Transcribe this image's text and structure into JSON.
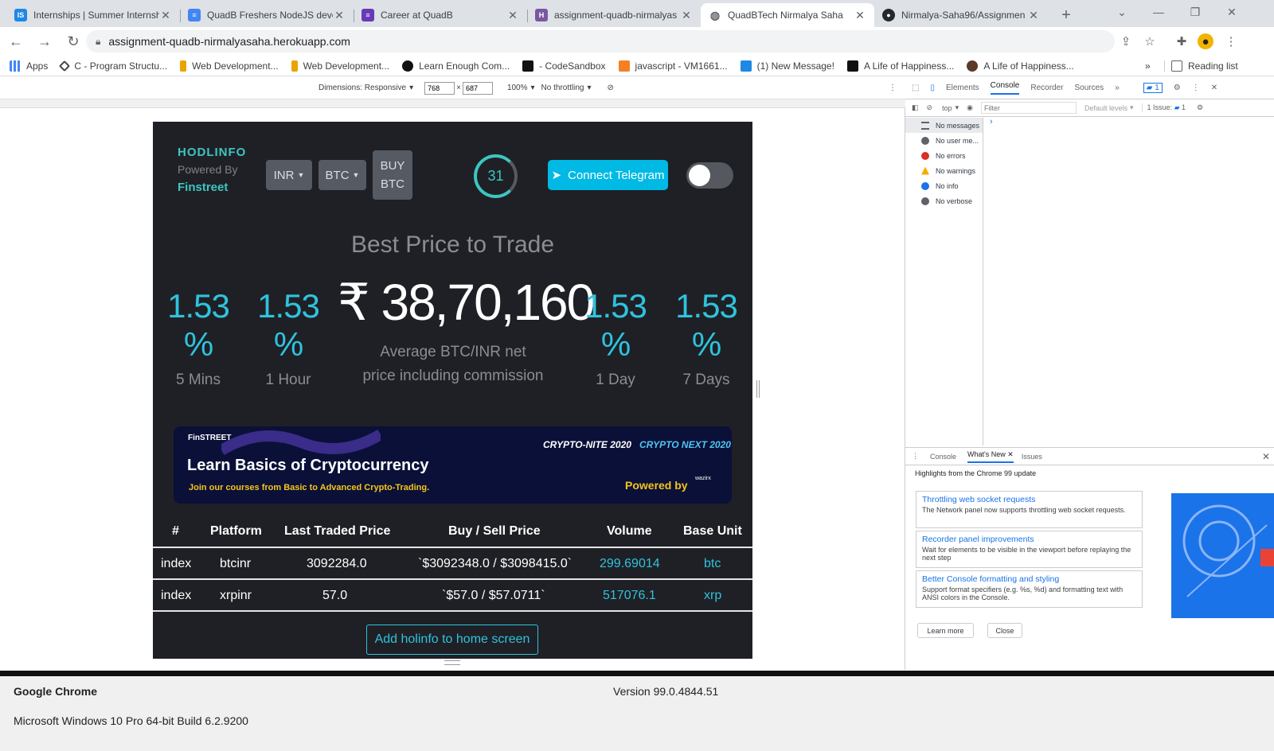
{
  "tabs": [
    {
      "title": "Internships | Summer Internsh",
      "favicon": "IS",
      "color": "#1e88e5"
    },
    {
      "title": "QuadB Freshers NodeJS deve",
      "favicon": "D",
      "color": "#4285f4"
    },
    {
      "title": "Career at QuadB",
      "favicon": "F",
      "color": "#673ab7"
    },
    {
      "title": "assignment-quadb-nirmalyas",
      "favicon": "H",
      "color": "#79589f"
    },
    {
      "title": "QuadBTech Nirmalya Saha",
      "favicon": "G",
      "color": "#5f6368"
    },
    {
      "title": "Nirmalya-Saha96/Assignmen",
      "favicon": "GH",
      "color": "#24292f"
    }
  ],
  "address": {
    "url": "assignment-quadb-nirmalyasaha.herokuapp.com"
  },
  "bookmarks": [
    {
      "label": "Apps",
      "color": "#4285f4"
    },
    {
      "label": "C - Program Structu...",
      "color": "#444"
    },
    {
      "label": "Web Development...",
      "color": "#e8a400"
    },
    {
      "label": "Web Development...",
      "color": "#e8a400"
    },
    {
      "label": "Learn Enough Com...",
      "color": "#111"
    },
    {
      "label": "- CodeSandbox",
      "color": "#111"
    },
    {
      "label": "javascript - VM1661...",
      "color": "#f48024"
    },
    {
      "label": "(1) New Message!",
      "color": "#1e88e5"
    },
    {
      "label": "A Life of Happiness...",
      "color": "#111"
    },
    {
      "label": "A Life of Happiness...",
      "color": "#5b3a29"
    }
  ],
  "reading_list": "Reading list",
  "device": {
    "dimensions": "Dimensions: Responsive",
    "width": "768",
    "height": "687",
    "zoom": "100%",
    "throttle": "No throttling"
  },
  "app": {
    "logo": "HODLINFO",
    "powered": "Powered By",
    "finstreet": "Finstreet",
    "currency": "INR",
    "coin": "BTC",
    "buy1": "BUY",
    "buy2": "BTC",
    "timer": "31",
    "telegram": "Connect Telegram",
    "best_price": "Best Price to Trade",
    "stats": [
      {
        "pct": "1.53 %",
        "label": "5 Mins"
      },
      {
        "pct": "1.53 %",
        "label": "1 Hour"
      },
      {
        "pct": "1.53 %",
        "label": "1 Day"
      },
      {
        "pct": "1.53 %",
        "label": "7 Days"
      }
    ],
    "price": "₹ 38,70,160",
    "avg1": "Average BTC/INR net",
    "avg2": "price including commission",
    "banner": {
      "brand": "FinSTREET",
      "title": "Learn Basics of Cryptocurrency",
      "sub": "Join our courses from Basic to Advanced Crypto-Trading.",
      "powered": "Powered by",
      "crypto_nite": "CRYPTO-NITE 2020",
      "crypto_next": "CRYPTO NEXT 2020",
      "wazirx": "wazirx"
    },
    "table": {
      "headers": [
        "#",
        "Platform",
        "Last Traded Price",
        "Buy / Sell Price",
        "Volume",
        "Base Unit"
      ],
      "rows": [
        [
          "index",
          "btcinr",
          "3092284.0",
          "`$3092348.0 / $3098415.0`",
          "299.69014",
          "btc"
        ],
        [
          "index",
          "xrpinr",
          "57.0",
          "`$57.0 / $57.0711`",
          "517076.1",
          "xrp"
        ]
      ]
    },
    "home_button": "Add holinfo to home screen"
  },
  "devtools": {
    "tabs": [
      "Elements",
      "Console",
      "Recorder",
      "Sources"
    ],
    "top": "top",
    "filter": "Filter",
    "levels": "Default levels",
    "issue": "1 Issue:",
    "issue_count": "1",
    "badge": "1",
    "sidebar": [
      {
        "label": "No messages",
        "color": "#5f6368"
      },
      {
        "label": "No user me...",
        "color": "#5f6368"
      },
      {
        "label": "No errors",
        "color": "#d93025"
      },
      {
        "label": "No warnings",
        "color": "#f9ab00"
      },
      {
        "label": "No info",
        "color": "#1a73e8"
      },
      {
        "label": "No verbose",
        "color": "#5f6368"
      }
    ],
    "drawer_tabs": [
      "Console",
      "What's New",
      "Issues"
    ],
    "highlights": "Highlights from the Chrome 99 update",
    "cards": [
      {
        "title": "Throttling web socket requests",
        "desc": "The Network panel now supports throttling web socket requests."
      },
      {
        "title": "Recorder panel improvements",
        "desc": "Wait for elements to be visible in the viewport before replaying the next step"
      },
      {
        "title": "Better Console formatting and styling",
        "desc": "Support format specifiers (e.g. %s, %d) and formatting text with ANSI colors in the Console."
      }
    ],
    "learn_more": "Learn more",
    "close": "Close"
  },
  "footer": {
    "product": "Google Chrome",
    "version": "Version 99.0.4844.51",
    "os": "Microsoft Windows 10 Pro 64-bit Build 6.2.9200"
  }
}
